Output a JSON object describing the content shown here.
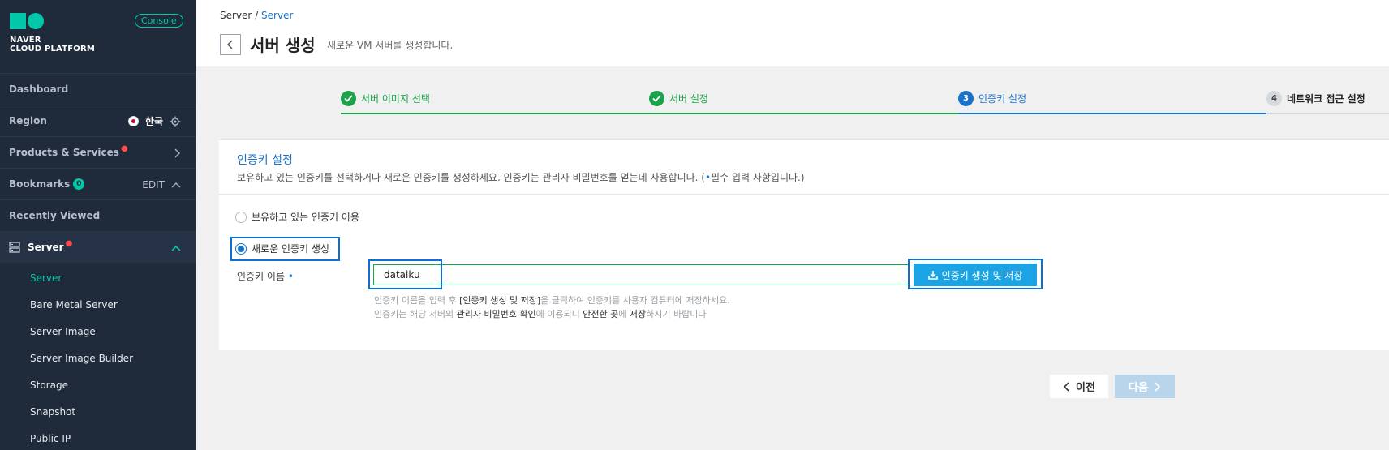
{
  "sidebar": {
    "console_badge": "Console",
    "logo_line1": "NAVER",
    "logo_line2": "CLOUD PLATFORM",
    "dashboard": "Dashboard",
    "region": "Region",
    "region_value": "한국",
    "products": "Products & Services",
    "bookmarks": "Bookmarks",
    "bookmarks_count": "0",
    "bookmarks_edit": "EDIT",
    "recently_viewed": "Recently Viewed",
    "server": "Server",
    "sub_items": [
      "Server",
      "Bare Metal Server",
      "Server Image",
      "Server Image Builder",
      "Storage",
      "Snapshot",
      "Public IP"
    ]
  },
  "header": {
    "breadcrumb_root": "Server /",
    "breadcrumb_current": "Server",
    "title": "서버 생성",
    "subtitle": "새로운 VM 서버를 생성합니다."
  },
  "steps": [
    {
      "label": "서버 이미지 선택",
      "state": "done"
    },
    {
      "label": "서버 설정",
      "state": "done"
    },
    {
      "label": "인증키 설정",
      "state": "active",
      "number": "3"
    },
    {
      "label": "네트워크 접근 설정",
      "state": "todo",
      "number": "4"
    }
  ],
  "card": {
    "title": "인증키 설정",
    "desc_before": "보유하고 있는 인증키를 선택하거나 새로운 인증키를 생성하세요. 인증키는 관리자 비밀번호를 얻는데 사용합니다. (",
    "desc_dot": "•",
    "desc_after": "필수 입력 사항입니다.)",
    "radio_existing": "보유하고 있는 인증키 이용",
    "radio_new": "새로운 인증키 생성",
    "field_label": "인증키 이름",
    "field_value": "dataiku",
    "gen_button": "인증키 생성 및 저장",
    "hint1_a": "인증키 이름을 입력 후 ",
    "hint1_b": "[인증키 생성 및 저장]",
    "hint1_c": "을 클릭하여 인증키를 사용자 컴퓨터에 저장하세요.",
    "hint2_a": "인증키는 해당 서버의 ",
    "hint2_b": "관리자 비밀번호 확인",
    "hint2_c": "에 이용되니 ",
    "hint2_d": "안전한 곳",
    "hint2_e": "에 ",
    "hint2_f": "저장",
    "hint2_g": "하시기 바랍니다"
  },
  "footer": {
    "prev": "이전",
    "next": "다음"
  },
  "colors": {
    "sidebar_bg": "#1f2a3a",
    "accent": "#03c7a9",
    "primary_blue": "#1a73c9",
    "done_green": "#1aa34a",
    "button_blue": "#1ba3e3"
  }
}
